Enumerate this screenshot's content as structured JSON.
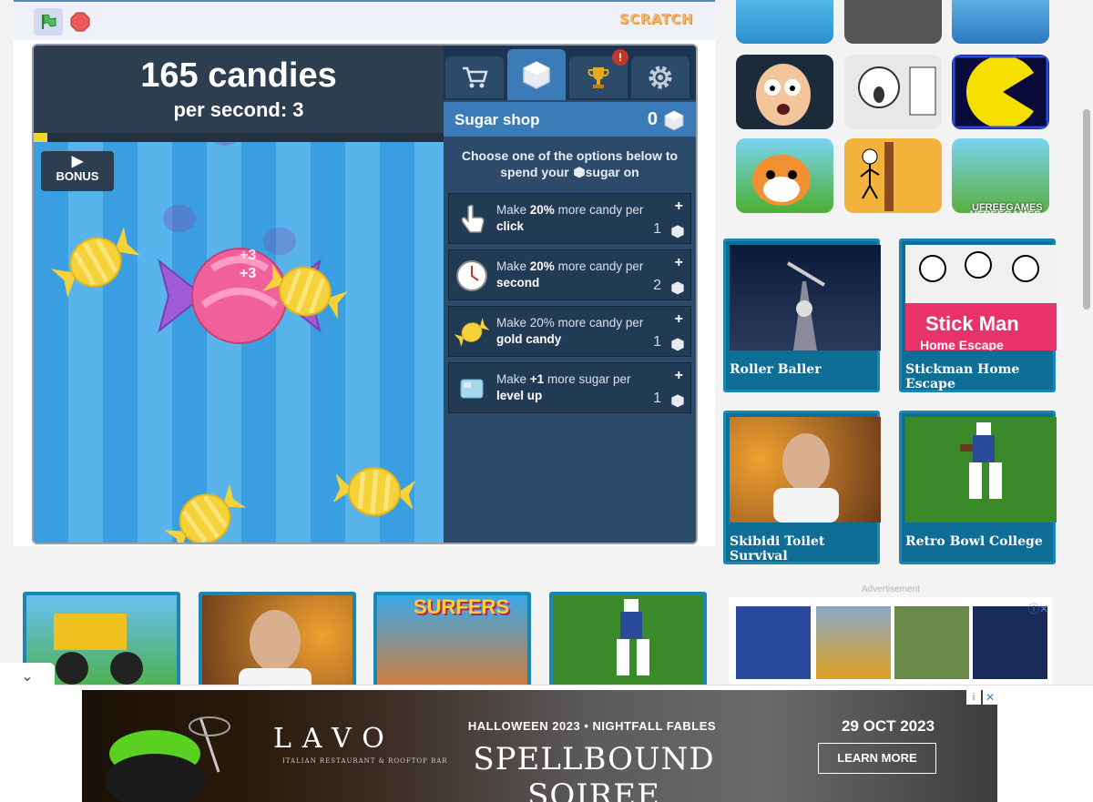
{
  "game": {
    "candy_count": "165  candies",
    "rate_label": "per second:",
    "rate_value": "3",
    "progress_pct": 2,
    "bonus_label": "BONUS",
    "float_numbers": [
      "+3",
      "+3"
    ],
    "scratch_logo": "SCRATCH",
    "shop": {
      "title": "Sugar shop",
      "sugar_count": "0",
      "alert": "!",
      "description_pre": "Choose one of the options below to spend your",
      "description_word": "sugar",
      "description_post": "on",
      "options": [
        {
          "prefix": "Make",
          "amount": "20%",
          "mid": "more candy per",
          "target": "click",
          "cost": "1",
          "icon": "pointer-hand-icon"
        },
        {
          "prefix": "Make",
          "amount": "20%",
          "mid": "more candy per",
          "target": "second",
          "cost": "2",
          "icon": "clock-icon"
        },
        {
          "prefix": "Make 20% more candy per",
          "amount": "",
          "mid": "",
          "target": "gold candy",
          "cost": "1",
          "icon": "gold-candy-icon"
        },
        {
          "prefix": "Make",
          "amount": "+1",
          "mid": "more sugar per",
          "target": "level up",
          "cost": "1",
          "icon": "ice-cube-icon"
        }
      ],
      "tabs": [
        "cart-icon",
        "sugar-cube-icon",
        "trophy-icon",
        "gear-icon"
      ]
    }
  },
  "sidebar": {
    "cards": [
      {
        "title": "Roller Baller"
      },
      {
        "title": "Stickman Home Escape"
      },
      {
        "title": "Skibidi Toilet Survival"
      },
      {
        "title": "Retro Bowl College"
      }
    ],
    "ufree_label": "UFREEGAMES",
    "stickman_overlay": "Stick Man",
    "stickman_overlay2": "Home Escape",
    "ad_label": "Advertisement"
  },
  "bottom_thumbs": [
    "monster-truck",
    "skibidi-toilet",
    "subway-surfers",
    "retro-bowl"
  ],
  "subway_text": "SURFERS",
  "footer_ad": {
    "brand": "LAVO",
    "brand_sub": "ITALIAN RESTAURANT & ROOFTOP BAR",
    "event_line": "HALLOWEEN 2023 • NIGHTFALL FABLES",
    "event_title": "SPELLBOUND SOIREE",
    "date": "29 OCT 2023",
    "cta": "LEARN MORE"
  },
  "colors": {
    "accent": "#3b7cb8",
    "card": "#0f6e96",
    "candy_pink": "#f0609a"
  }
}
